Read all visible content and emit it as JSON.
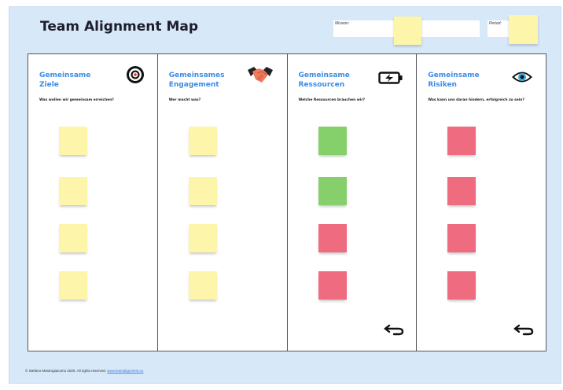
{
  "header": {
    "title": "Team Alignment Map",
    "mission_label": "Mission:",
    "period_label": "Period:"
  },
  "columns": [
    {
      "title": "Gemeinsame\nZiele",
      "question": "Was wollen wir gemeinsam erreichen?",
      "icon": "target-icon",
      "notes": [
        "yellow",
        "yellow",
        "yellow",
        "yellow"
      ]
    },
    {
      "title": "Gemeinsames\nEngagement",
      "question": "Wer macht was?",
      "icon": "handshake-icon",
      "notes": [
        "yellow",
        "yellow",
        "yellow",
        "yellow"
      ]
    },
    {
      "title": "Gemeinsame\nRessourcen",
      "question": "Welche Ressourcen brauchen wir?",
      "icon": "battery-icon",
      "notes": [
        "green",
        "green",
        "red",
        "red"
      ],
      "has_back_arrow": true
    },
    {
      "title": "Gemeinsame\nRisiken",
      "question": "Was kann uns daran hindern, erfolgreich zu sein?",
      "icon": "eye-icon",
      "notes": [
        "red",
        "red",
        "red",
        "red"
      ],
      "has_back_arrow": true
    }
  ],
  "footer": {
    "copyright": "© Stefano Mastrogiacomo 2020. All rights reserved.",
    "link": "www.teamalignment.co"
  },
  "colors": {
    "background": "#d7e8f8",
    "accent": "#3c8ce6",
    "note_yellow": "#fdf5a9",
    "note_green": "#86d06c",
    "note_red": "#ef6b80"
  }
}
